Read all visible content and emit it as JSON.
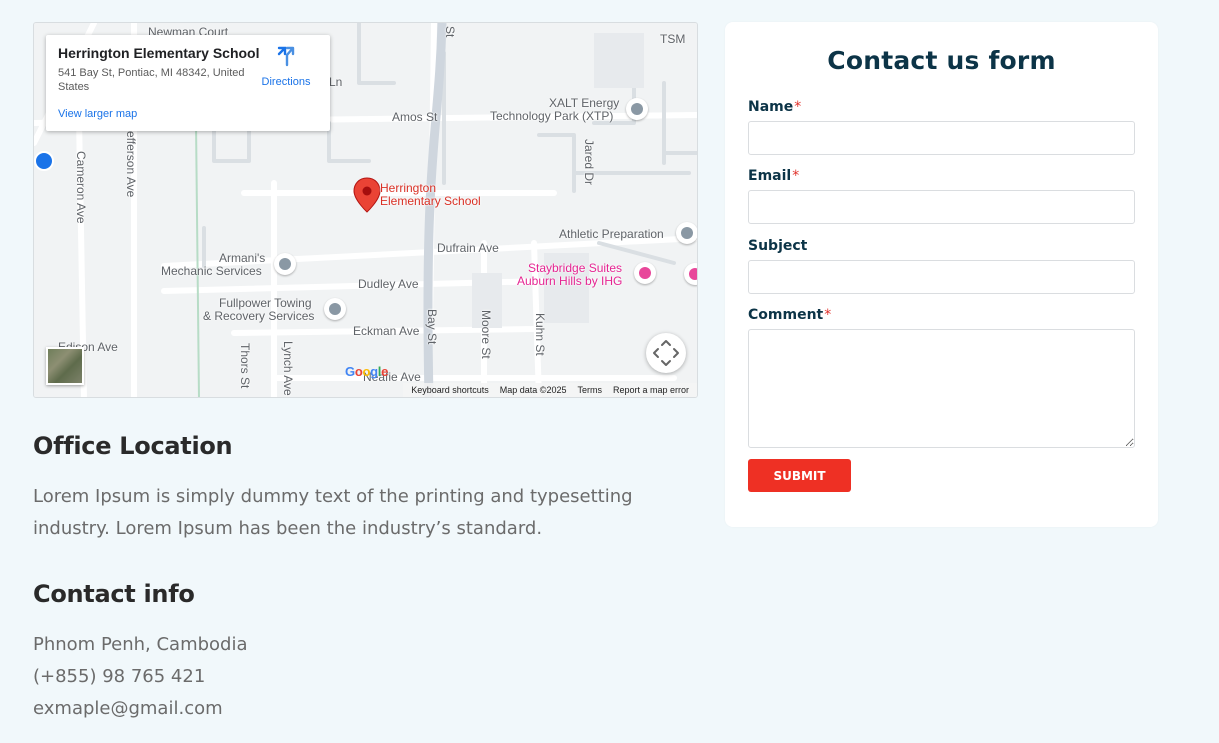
{
  "map": {
    "place_name": "Herrington Elementary School",
    "place_address": "541 Bay St, Pontiac, MI 48342, United States",
    "directions_label": "Directions",
    "view_larger_label": "View larger map",
    "pin_label_line1": "Herrington",
    "pin_label_line2": "Elementary School",
    "labels": {
      "newman_court": "Newman Court",
      "tsm": "TSM",
      "ln": "Ln",
      "amos_st": "Amos St",
      "xalt_line1": "XALT Energy",
      "xalt_line2": "Technology Park (XTP)",
      "jared_dr": "Jared Dr",
      "athletic": "Athletic Preparation",
      "dufrain": "Dufrain Ave",
      "armanis_line1": "Armani's",
      "armanis_line2": "Mechanic Services",
      "dudley": "Dudley Ave",
      "staybridge_line1": "Staybridge Suites",
      "staybridge_line2": "Auburn Hills by IHG",
      "fullpower_line1": "Fullpower Towing",
      "fullpower_line2": "& Recovery Services",
      "eckman": "Eckman Ave",
      "cameron": "Cameron Ave",
      "jefferson": "Jefferson Ave",
      "bay_st": "Bay St",
      "moore_st": "Moore St",
      "kuhn_st": "Kuhn St",
      "thors_st": "Thors St",
      "lynch_ave": "Lynch Ave",
      "neafie": "Neafie Ave",
      "edison": "Edison Ave",
      "st_top": "St"
    },
    "google_logo": "Google",
    "footer": {
      "shortcuts": "Keyboard shortcuts",
      "map_data": "Map data ©2025",
      "terms": "Terms",
      "report": "Report a map error"
    },
    "colors": {
      "pin": "#ea4335",
      "link": "#1a73e8",
      "poi_gray": "#8a98a4",
      "poi_pink": "#e8479a"
    }
  },
  "office": {
    "heading": "Office Location",
    "text": "Lorem Ipsum is simply dummy text of the printing and typesetting industry. Lorem Ipsum has been the industry’s standard."
  },
  "contact": {
    "heading": "Contact info",
    "city": "Phnom Penh, Cambodia",
    "phone": "(+855) 98 765 421",
    "email": "exmaple@gmail.com"
  },
  "form": {
    "title": "Contact us form",
    "name_label": "Name",
    "email_label": "Email",
    "subject_label": "Subject",
    "comment_label": "Comment",
    "required_mark": "*",
    "name_value": "",
    "email_value": "",
    "subject_value": "",
    "comment_value": "",
    "submit_label": "SUBMIT",
    "colors": {
      "accent": "#ee3024",
      "heading": "#0c3447"
    }
  }
}
